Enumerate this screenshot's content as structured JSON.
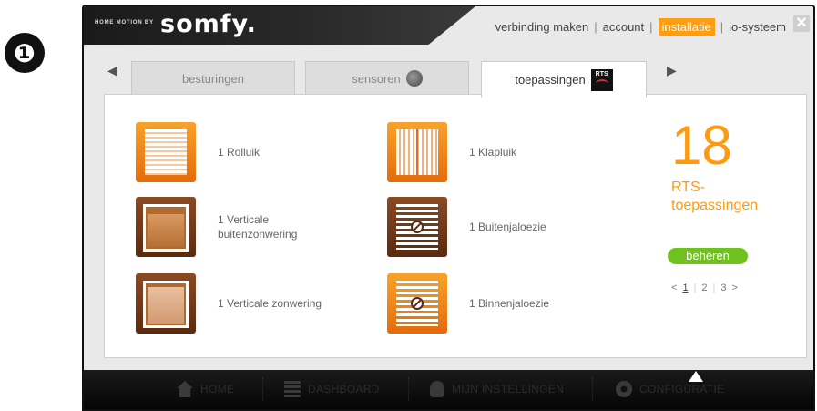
{
  "step_number": "❶",
  "header": {
    "brand_small": "HOME MOTION BY",
    "brand_main": "somfy.",
    "nav": [
      "verbinding maken",
      "account",
      "installatie",
      "io-systeem"
    ],
    "nav_active_index": 2,
    "close_label": "✕"
  },
  "tabs": [
    {
      "label": "besturingen",
      "active": false
    },
    {
      "label": "sensoren",
      "active": false
    },
    {
      "label": "toepassingen",
      "active": true
    }
  ],
  "tab_icon_rts": "RTS",
  "applications": [
    {
      "label": "1 Rolluik",
      "icon": "roller-shutter-icon"
    },
    {
      "label": "1 Klapluik",
      "icon": "hinged-shutter-icon"
    },
    {
      "label": "1 Verticale buitenzonwering",
      "icon": "exterior-screen-icon"
    },
    {
      "label": "1 Buitenjaloezie",
      "icon": "exterior-venetian-blind-icon"
    },
    {
      "label": "1 Verticale zonwering",
      "icon": "vertical-awning-icon"
    },
    {
      "label": "1 Binnenjaloezie",
      "icon": "interior-venetian-blind-icon"
    }
  ],
  "summary": {
    "count": "18",
    "label": "RTS-toepassingen",
    "manage_button": "beheren"
  },
  "pager": {
    "prev": "<",
    "pages": [
      "1",
      "2",
      "3"
    ],
    "current": "1",
    "next": ">"
  },
  "footer": [
    "HOME",
    "DASHBOARD",
    "MIJN INSTELLINGEN",
    "CONFIGURATIE"
  ],
  "colors": {
    "accent_orange": "#ff9a10",
    "button_green": "#6fc21d",
    "dark": "#1a1a1a"
  }
}
